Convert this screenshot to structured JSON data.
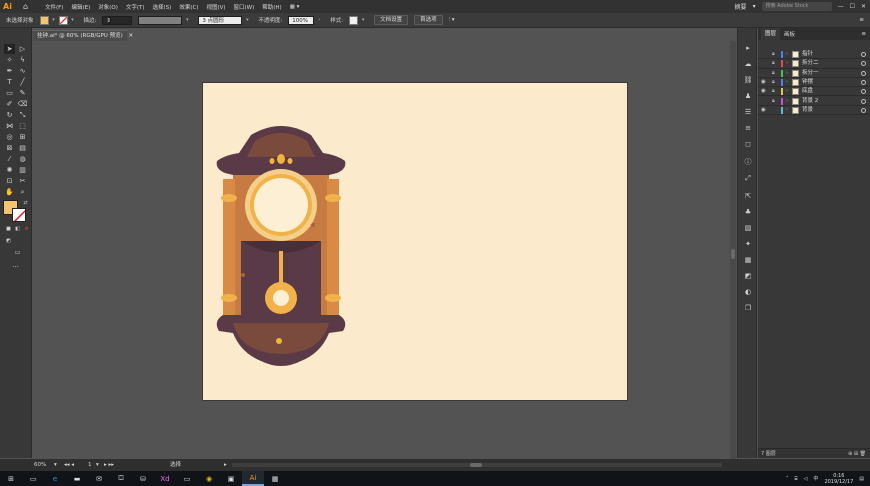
{
  "menubar": {
    "logo": "Ai",
    "items": [
      "文件(F)",
      "编辑(E)",
      "对象(O)",
      "文字(T)",
      "选择(S)",
      "效果(C)",
      "视图(V)",
      "窗口(W)",
      "帮助(H)"
    ],
    "workspace": "摘要",
    "search_placeholder": "搜索 Adobe Stock"
  },
  "controlbar": {
    "selection_status": "未选择对象",
    "stroke_label": "描边:",
    "stroke_profile": "3 点圆形",
    "opacity_label": "不透明度:",
    "opacity_value": "100%",
    "style_label": "样式:",
    "doc_setup_button": "文档设置",
    "preferences_button": "首选项"
  },
  "document": {
    "tab_title": "挂钟.ai* @ 60% (RGB/GPU 预览)"
  },
  "layers_panel": {
    "tab_layers": "图层",
    "tab_artboards": "画板",
    "layers": [
      {
        "name": "指针",
        "visible": false,
        "color": "#4f7fff"
      },
      {
        "name": "拆分二",
        "visible": false,
        "color": "#e04f4f"
      },
      {
        "name": "拆分一",
        "visible": false,
        "color": "#4fc24f"
      },
      {
        "name": "钟摆",
        "visible": true,
        "color": "#4f7fff"
      },
      {
        "name": "底盘",
        "visible": true,
        "color": "#e0c84f"
      },
      {
        "name": "背景 2",
        "visible": false,
        "color": "#c84fe0"
      },
      {
        "name": "背景",
        "visible": true,
        "color": "#4fc2e0"
      }
    ],
    "footer_count": "7 图层"
  },
  "statusbar": {
    "zoom": "60%",
    "artboard_number": "1",
    "tool_name": "选择"
  },
  "taskbar": {
    "time": "0:16",
    "date": "2019/12/17"
  },
  "colors": {
    "fill_swatch": "#f5c46f",
    "artboard": "#fbebcc"
  }
}
